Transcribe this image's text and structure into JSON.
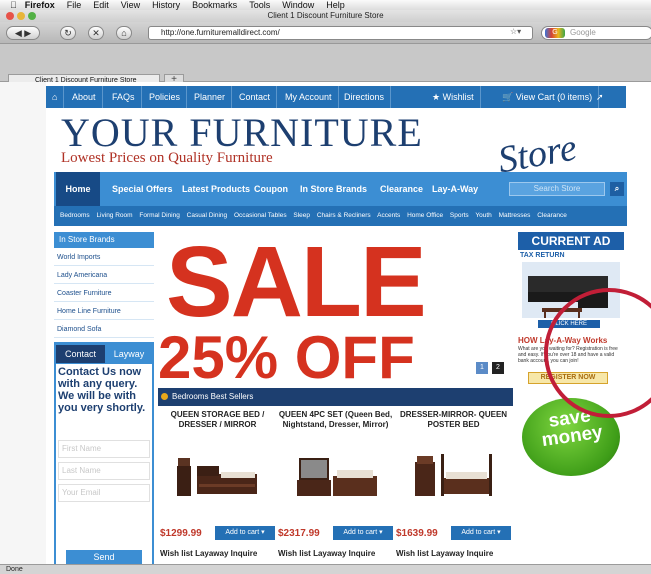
{
  "menubar": {
    "app": "Firefox",
    "items": [
      "File",
      "Edit",
      "View",
      "History",
      "Bookmarks",
      "Tools",
      "Window",
      "Help"
    ]
  },
  "window": {
    "title": "Client 1 Discount Furniture Store"
  },
  "toolbar": {
    "url": "http://one.furnituremalldirect.com/",
    "search_placeholder": "Google"
  },
  "tabs": [
    {
      "label": "Client 1 Discount Furniture Store"
    }
  ],
  "topnav": {
    "items": [
      "About",
      "FAQs",
      "Policies",
      "Planner",
      "Contact",
      "My Account",
      "Directions"
    ],
    "wishlist": "Wishlist",
    "cart": "View Cart (0 items)",
    "login": "Login"
  },
  "logo": {
    "line1": "YOUR FURNITURE",
    "tagline": "Lowest Prices on Quality Furniture",
    "script": "Store"
  },
  "mainnav": {
    "items": [
      "Home",
      "Special Offers",
      "Latest Products",
      "Coupon",
      "In Store Brands",
      "Clearance",
      "Lay-A-Way"
    ],
    "search_placeholder": "Search Store"
  },
  "subnav": {
    "items": [
      "Bedrooms",
      "Living Room",
      "Formal Dining",
      "Casual Dining",
      "Occasional Tables",
      "Sleep",
      "Chairs & Recliners",
      "Accents",
      "Home Office",
      "Sports",
      "Youth",
      "Mattresses",
      "Clearance"
    ]
  },
  "sidebar": {
    "title": "In Store Brands",
    "brands": [
      "World Imports",
      "Lady Americana",
      "Coaster Furniture",
      "Home Line Furniture",
      "Diamond Sofa"
    ],
    "contact_tab": "Contact",
    "layway_tab": "Layway",
    "message": "Contact Us now with any query. We will be with you very shortly.",
    "first_name": "First Name",
    "last_name": "Last Name",
    "email": "Your Email",
    "send": "Send"
  },
  "banner": {
    "sale": "SALE",
    "off": "25% OFF",
    "dots": [
      "1",
      "2"
    ]
  },
  "bestsellers": {
    "title": "Bedrooms Best Sellers",
    "products": [
      {
        "title": "QUEEN STORAGE BED / DRESSER / MIRROR",
        "price": "$1299.99",
        "cart": "Add to cart",
        "wish": "Wish list",
        "layaway": "Layaway",
        "inquire": "Inquire"
      },
      {
        "title": "QUEEN 4PC SET (Queen Bed, Nightstand, Dresser, Mirror)",
        "price": "$2317.99",
        "cart": "Add to cart",
        "wish": "Wish list",
        "layaway": "Layaway",
        "inquire": "Inquire"
      },
      {
        "title": "DRESSER-MIRROR- QUEEN POSTER BED",
        "price": "$1639.99",
        "cart": "Add to cart",
        "wish": "Wish list",
        "layaway": "Layaway",
        "inquire": "Inquire"
      }
    ]
  },
  "right": {
    "current_ad": "CURRENT AD",
    "tax_return": "TAX RETURN",
    "click_here": "CLICK HERE",
    "how_layaway": "HOW Lay-A-Way Works",
    "how_text": "What are you waiting for? Registration is free and easy. If you're over 18 and have a valid bank account, you can join!",
    "register": "REGISTER NOW",
    "save": "save money"
  },
  "status": {
    "text": "Done"
  },
  "colors": {
    "brand_blue": "#2470b5",
    "navy": "#1d3f70",
    "sale_red": "#d5321f",
    "highlight_circle": "#c11e37"
  }
}
